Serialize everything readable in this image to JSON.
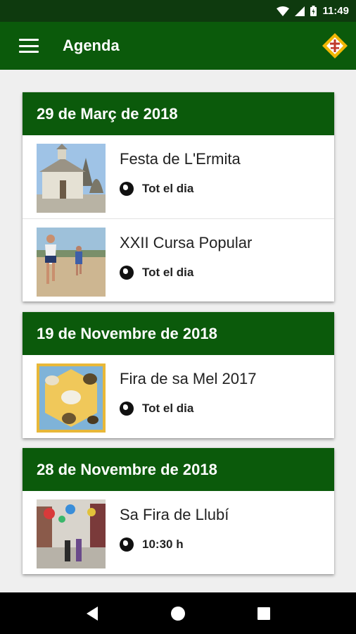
{
  "status_bar": {
    "time": "11:49"
  },
  "app_bar": {
    "title": "Agenda"
  },
  "days": [
    {
      "date": "29 de Març de 2018",
      "events": [
        {
          "title": "Festa de L'Ermita",
          "time": "Tot el dia"
        },
        {
          "title": "XXII Cursa Popular",
          "time": "Tot el dia"
        }
      ]
    },
    {
      "date": "19 de Novembre de 2018",
      "events": [
        {
          "title": "Fira de sa Mel 2017",
          "time": "Tot el dia"
        }
      ]
    },
    {
      "date": "28 de Novembre de 2018",
      "events": [
        {
          "title": "Sa Fira de Llubí",
          "time": "10:30 h"
        }
      ]
    }
  ],
  "colors": {
    "primary": "#0b5a0b",
    "status_bar": "#0e3a0e",
    "background": "#efefef"
  }
}
